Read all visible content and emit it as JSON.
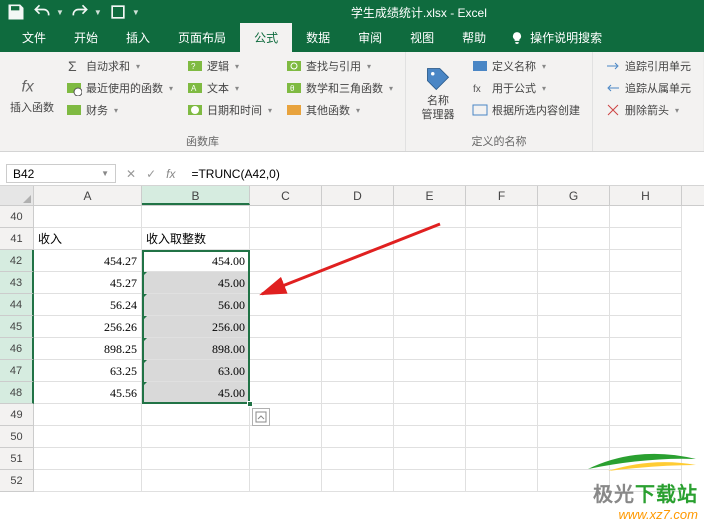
{
  "titlebar": {
    "doc_title": "学生成绩统计.xlsx - Excel"
  },
  "ribbon": {
    "tabs": [
      "文件",
      "开始",
      "插入",
      "页面布局",
      "公式",
      "数据",
      "审阅",
      "视图",
      "帮助"
    ],
    "active_tab": 4,
    "tell_me": "操作说明搜索",
    "groups": {
      "insert_fn": {
        "btn": "插入函数",
        "label": "函数库"
      },
      "lib": {
        "autosum": "自动求和",
        "recent": "最近使用的函数",
        "financial": "财务",
        "logical": "逻辑",
        "text": "文本",
        "datetime": "日期和时间",
        "lookup": "查找与引用",
        "math": "数学和三角函数",
        "other": "其他函数"
      },
      "names": {
        "mgr": "名称\n管理器",
        "label": "定义的名称",
        "define": "定义名称",
        "use": "用于公式",
        "create": "根据所选内容创建"
      },
      "audit": {
        "trace_prec": "追踪引用单元",
        "trace_dep": "追踪从属单元",
        "remove": "删除箭头"
      }
    }
  },
  "namebox": "B42",
  "formula": "=TRUNC(A42,0)",
  "columns": [
    "A",
    "B",
    "C",
    "D",
    "E",
    "F",
    "G",
    "H"
  ],
  "rows": [
    40,
    41,
    42,
    43,
    44,
    45,
    46,
    47,
    48,
    49,
    50,
    51,
    52
  ],
  "selected_rows": [
    42,
    43,
    44,
    45,
    46,
    47,
    48
  ],
  "data": {
    "header_a": "收入",
    "header_b": "收入取整数",
    "a": [
      "454.27",
      "45.27",
      "56.24",
      "256.26",
      "898.25",
      "63.25",
      "45.56"
    ],
    "b": [
      "454.00",
      "45.00",
      "56.00",
      "256.00",
      "898.00",
      "63.00",
      "45.00"
    ]
  },
  "watermark": {
    "brand_gray": "极光",
    "brand_green": "下载站",
    "url": "www.xz7.com"
  }
}
